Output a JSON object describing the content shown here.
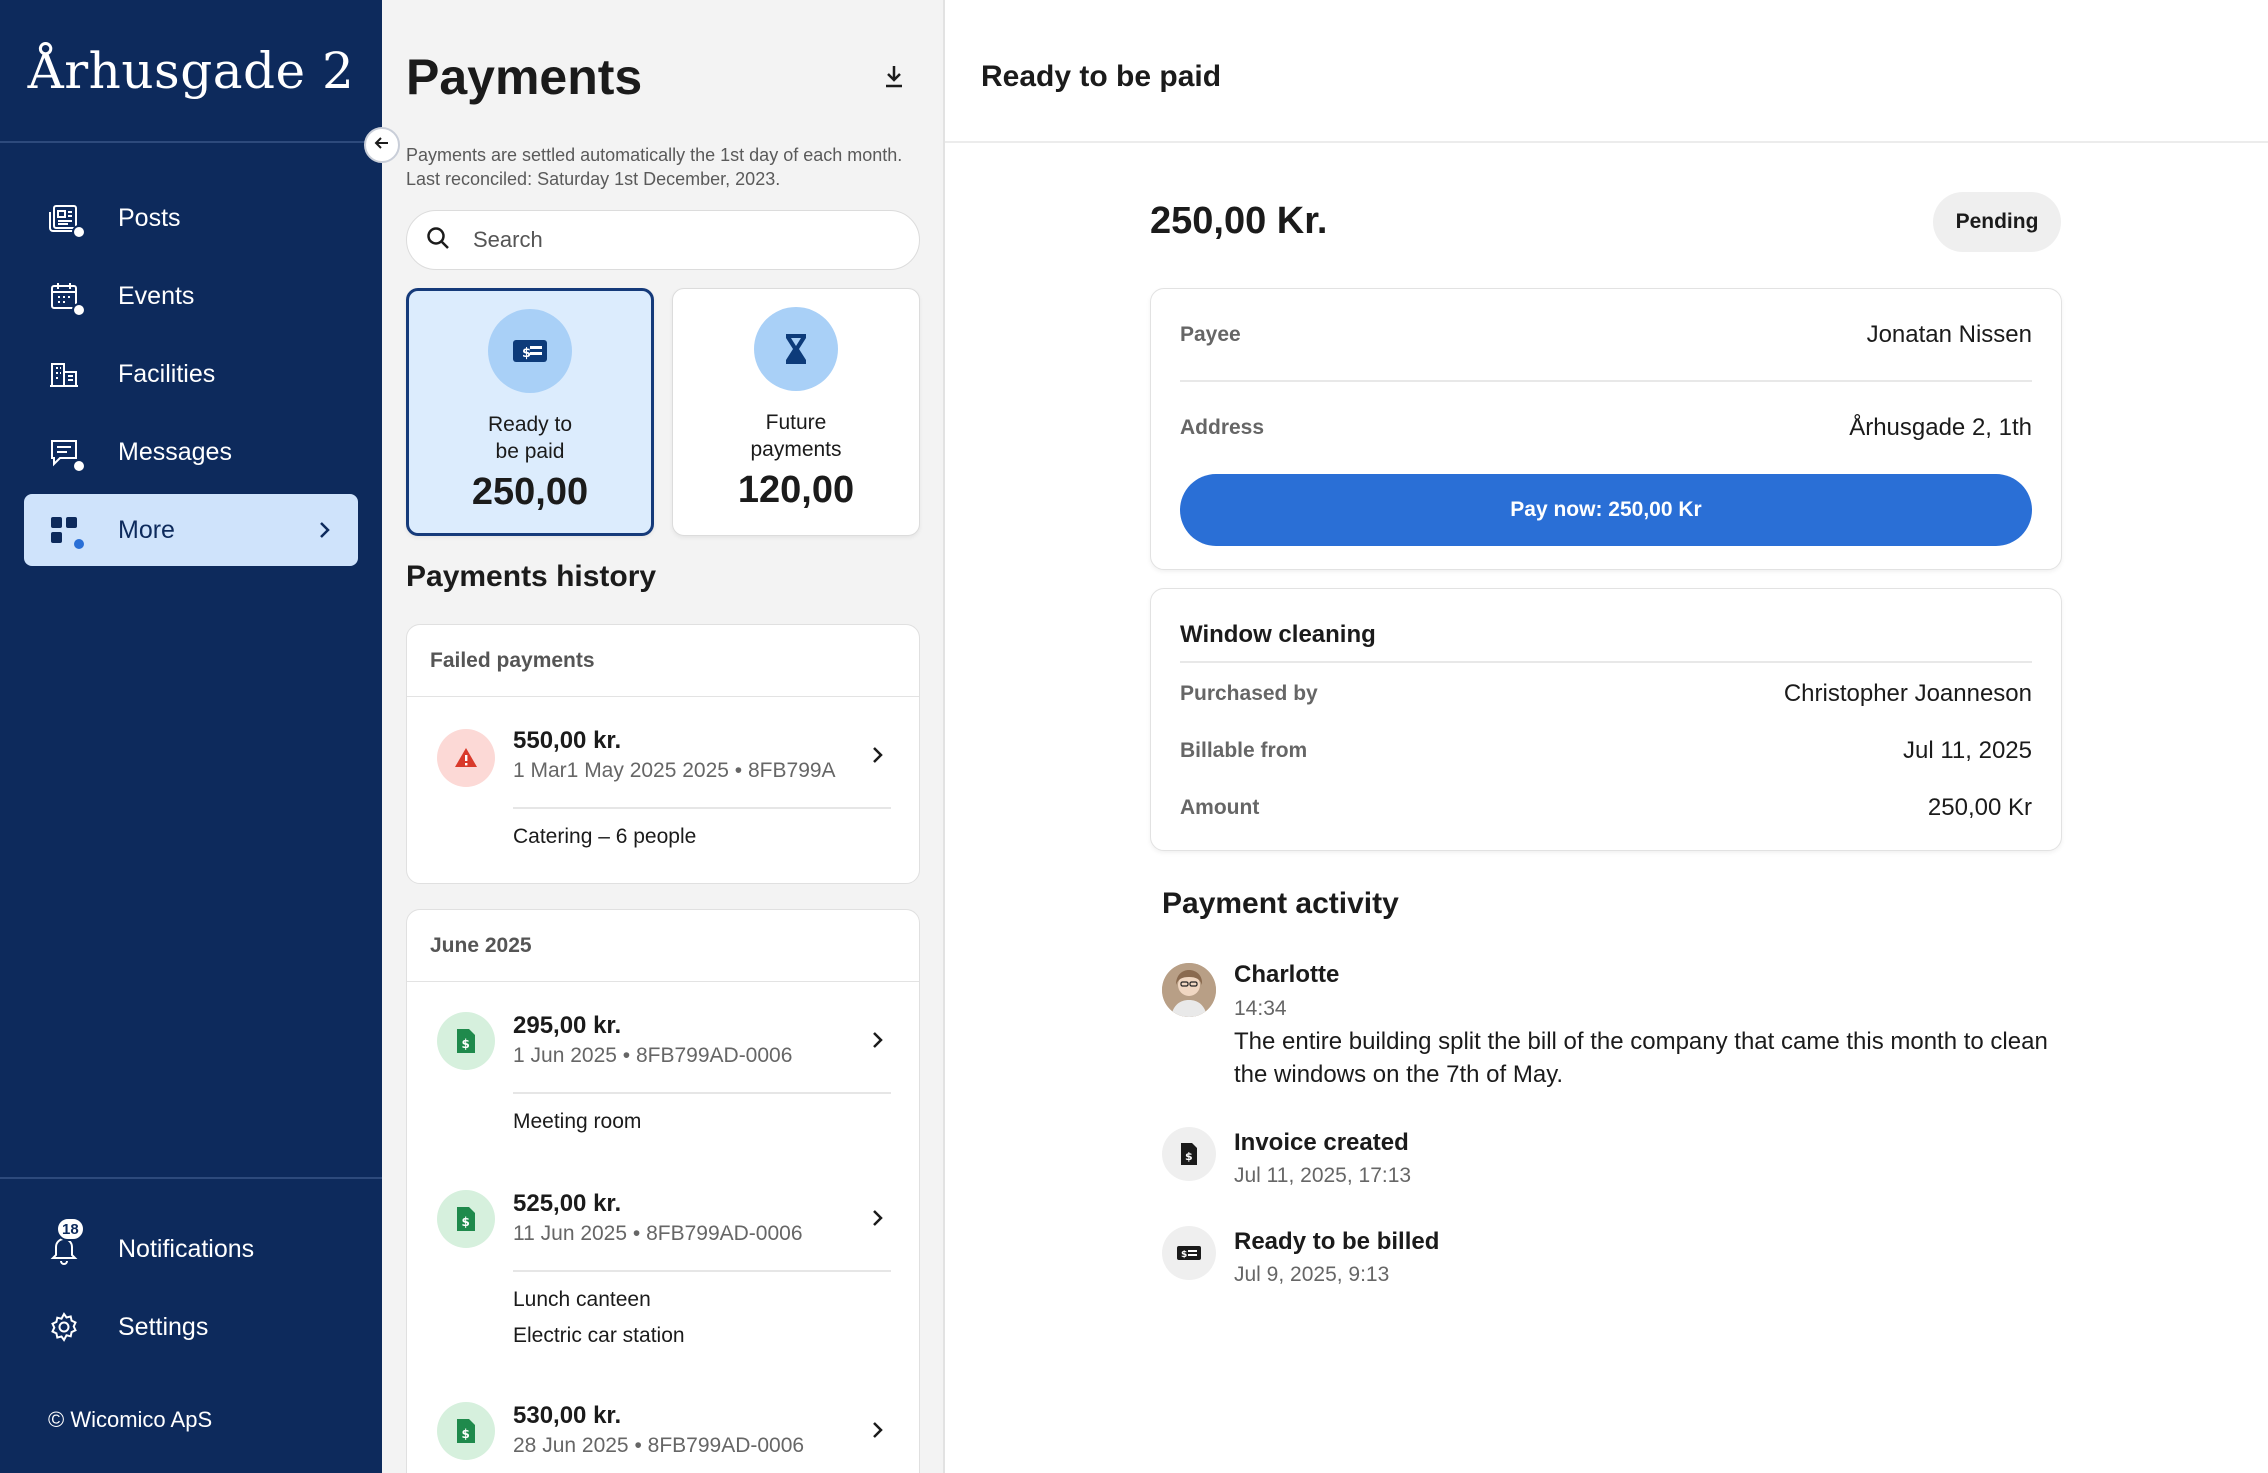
{
  "app": {
    "brand": "Århusgade 2",
    "copyright": "© Wicomico ApS"
  },
  "sidebar": {
    "items": [
      {
        "label": "Posts",
        "icon": "posts-icon"
      },
      {
        "label": "Events",
        "icon": "events-icon"
      },
      {
        "label": "Facilities",
        "icon": "facilities-icon"
      },
      {
        "label": "Messages",
        "icon": "messages-icon"
      },
      {
        "label": "More",
        "icon": "grid-icon",
        "active": true
      }
    ],
    "bottom": [
      {
        "label": "Notifications",
        "icon": "bell-icon",
        "badge": "18"
      },
      {
        "label": "Settings",
        "icon": "gear-icon"
      }
    ]
  },
  "payments": {
    "title": "Payments",
    "description_line1": "Payments are settled automatically the 1st day of each month.",
    "description_line2": "Last reconciled: Saturday 1st December, 2023.",
    "search_placeholder": "Search",
    "summary": [
      {
        "line1": "Ready to",
        "line2": "be paid",
        "value": "250,00",
        "selected": true
      },
      {
        "line1": "Future",
        "line2": "payments",
        "value": "120,00",
        "selected": false
      }
    ],
    "history_title": "Payments history",
    "groups": [
      {
        "title": "Failed payments",
        "items": [
          {
            "amount": "550,00 kr.",
            "date": "1 Mar1 May 2025 2025",
            "ref": "8FB799A",
            "notes": [
              "Catering – 6 people"
            ],
            "status": "failed"
          }
        ]
      },
      {
        "title": "June 2025",
        "items": [
          {
            "amount": "295,00 kr.",
            "date": "1 Jun 2025",
            "ref": "8FB799AD-0006",
            "notes": [
              "Meeting room"
            ],
            "status": "ok"
          },
          {
            "amount": "525,00 kr.",
            "date": "11 Jun 2025",
            "ref": "8FB799AD-0006",
            "notes": [
              "Lunch canteen",
              "Electric car station"
            ],
            "status": "ok"
          },
          {
            "amount": "530,00 kr.",
            "date": "28 Jun 2025",
            "ref": "8FB799AD-0006",
            "notes": [],
            "status": "ok"
          }
        ]
      }
    ]
  },
  "detail": {
    "header": "Ready to be paid",
    "amount": "250,00 Kr.",
    "status": "Pending",
    "payee_label": "Payee",
    "payee_value": "Jonatan Nissen",
    "address_label": "Address",
    "address_value": "Århusgade 2, 1th",
    "pay_button": "Pay now: 250,00 Kr",
    "item": {
      "title": "Window cleaning",
      "purchased_by_label": "Purchased by",
      "purchased_by_value": "Christopher Joanneson",
      "billable_label": "Billable from",
      "billable_value": "Jul 11, 2025",
      "amount_label": "Amount",
      "amount_value": "250,00 Kr"
    },
    "activity_title": "Payment activity",
    "activity": [
      {
        "name": "Charlotte",
        "time": "14:34",
        "text": "The entire building split the bill of the company that came this month to clean the windows on the 7th of May."
      },
      {
        "name": "Invoice created",
        "time": "Jul 11, 2025, 17:13"
      },
      {
        "name": "Ready to be billed",
        "time": "Jul 9, 2025, 9:13"
      }
    ]
  },
  "colors": {
    "sidebar": "#0d2a5c",
    "accent": "#2a6fd6",
    "selected_card": "#dcecfd",
    "failed": "#d93a2b",
    "ok": "#1f8a4c"
  }
}
